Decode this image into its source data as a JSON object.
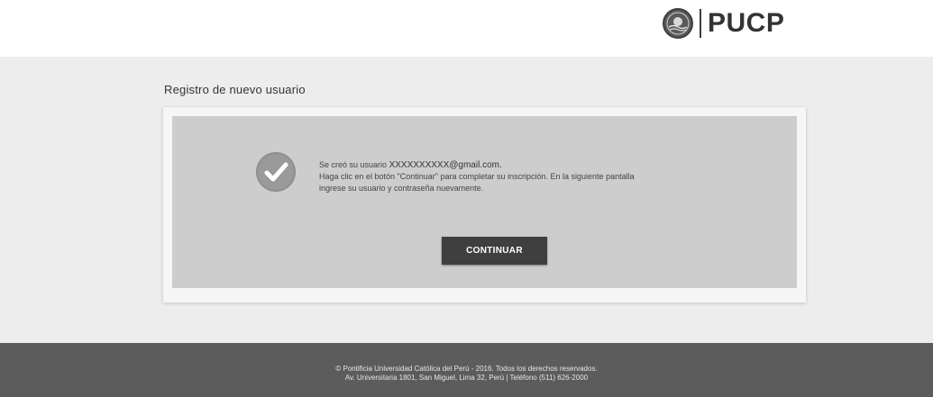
{
  "header": {
    "logo_text": "PUCP",
    "logo_icon": "pucp-seal-icon"
  },
  "main": {
    "page_title": "Registro de nuevo usuario",
    "success_icon": "check-circle-icon",
    "message_line1_prefix": "Se creó su usuario",
    "message_user": "XXXXXXXXXX@gmail.com.",
    "message_line2": "Haga clic en el botón \"Continuar\" para completar su inscripción. En la siguiente pantalla",
    "message_line3": "ingrese su usuario y contraseña nuevamente.",
    "continue_label": "CONTINUAR"
  },
  "footer": {
    "line1": "© Pontificia Universidad Católica del Perú - 2016. Todos los derechos reservados.",
    "line2": "Av. Universitaria 1801, San Miguel, Lima 32, Perú | Teléfono (511) 626-2000"
  },
  "colors": {
    "footer_bg": "#5c5c5c",
    "button_bg": "#3f3f3f",
    "panel_bg": "#cdcdcd"
  }
}
